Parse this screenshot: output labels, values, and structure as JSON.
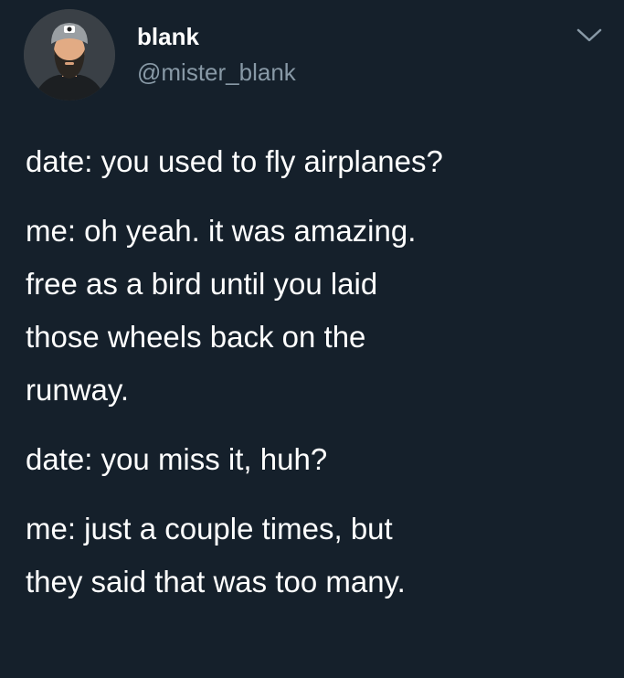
{
  "user": {
    "display_name": "blank",
    "handle": "@mister_blank",
    "avatar_icon": "profile-avatar-bearded-man-with-cap"
  },
  "menu": {
    "chevron_icon": "chevron-down-icon"
  },
  "tweet": {
    "lines": [
      "date: you used to fly airplanes?",
      "me: oh yeah. it was amazing.\nfree as a bird until you laid\nthose wheels back on the\nrunway.",
      "date: you miss it, huh?",
      "me: just a couple times, but\nthey said that was too many."
    ]
  },
  "colors": {
    "background": "#15202b",
    "text_primary": "#ffffff",
    "text_secondary": "#8899a6"
  }
}
